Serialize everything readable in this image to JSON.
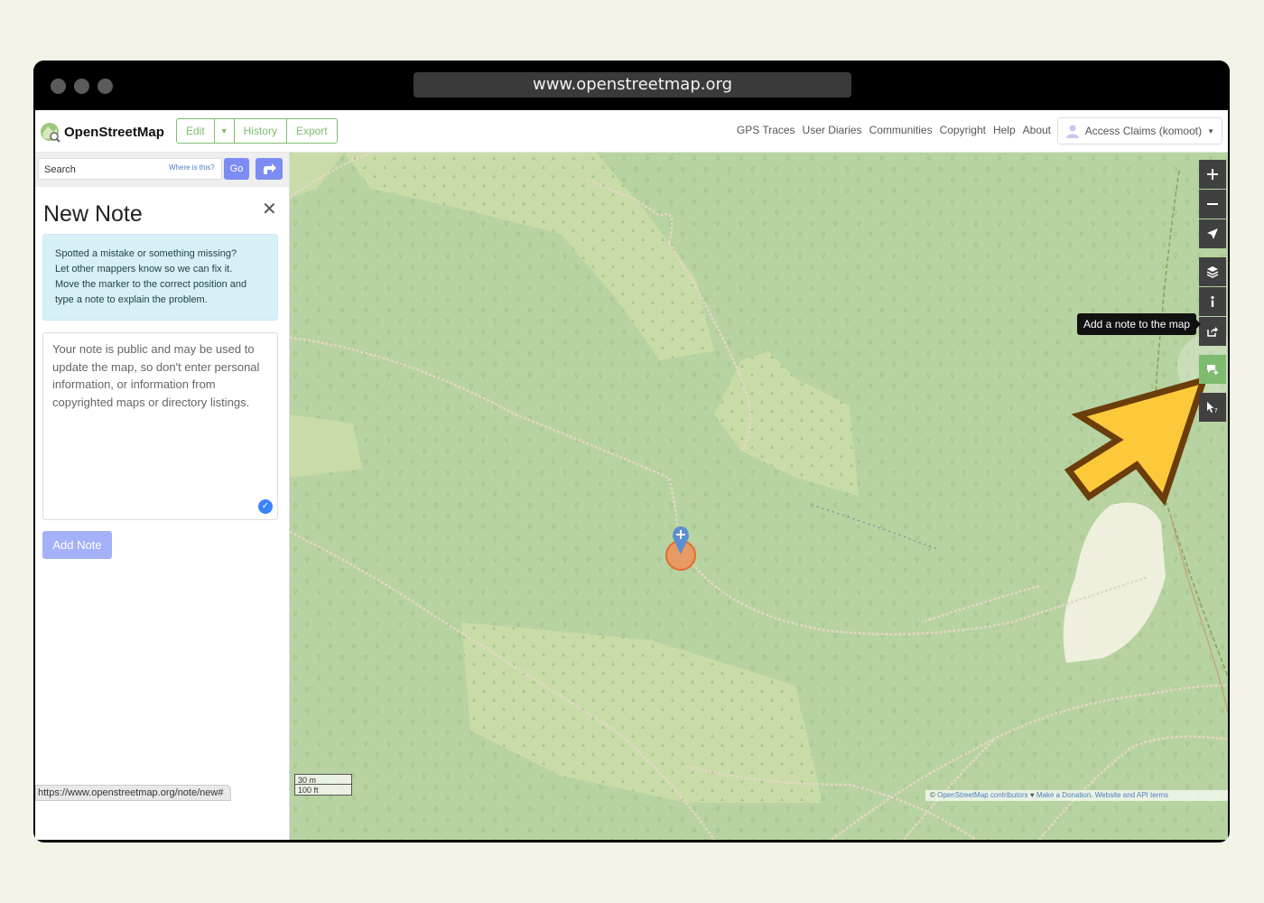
{
  "browser": {
    "url": "www.openstreetmap.org"
  },
  "navbar": {
    "logo_text": "OpenStreetMap",
    "buttons": [
      "Edit",
      "History",
      "Export"
    ],
    "links": [
      "GPS Traces",
      "User Diaries",
      "Communities",
      "Copyright",
      "Help",
      "About"
    ],
    "account_label": "Access Claims (komoot)"
  },
  "sidebar": {
    "search_placeholder": "Search",
    "where_is_this": "Where is this?",
    "go_label": "Go",
    "title": "New Note",
    "info_lines": [
      "Spotted a mistake or something missing?",
      "Let other mappers know so we can fix it.",
      "Move the marker to the correct position and",
      "type a note to explain the problem."
    ],
    "textarea_lines": [
      "Your note is public and may be used to",
      "update the map, so don't enter personal",
      "information, or information from",
      "copyrighted maps or directory listings."
    ],
    "add_note_label": "Add Note"
  },
  "map": {
    "tooltip": "Add a note to the map",
    "scale_metric": "30 m",
    "scale_imperial": "100 ft",
    "attribution_prefix": "© ",
    "attribution_contrib": "OpenStreetMap contributors",
    "attribution_heart": " ♥ ",
    "attribution_donate": "Make a Donation",
    "attribution_sep": ". ",
    "attribution_terms": "Website and API terms"
  },
  "status_bar_url": "https://www.openstreetmap.org/note/new#",
  "colors": {
    "map_base": "#b7d3a1",
    "map_light": "#c9dca8",
    "clearing": "#eef0dd",
    "osm_green": "#7ebc6f",
    "button_blue": "#7c8cf2",
    "arrow_fill": "#fcc93a",
    "arrow_stroke": "#6b3d0a"
  }
}
